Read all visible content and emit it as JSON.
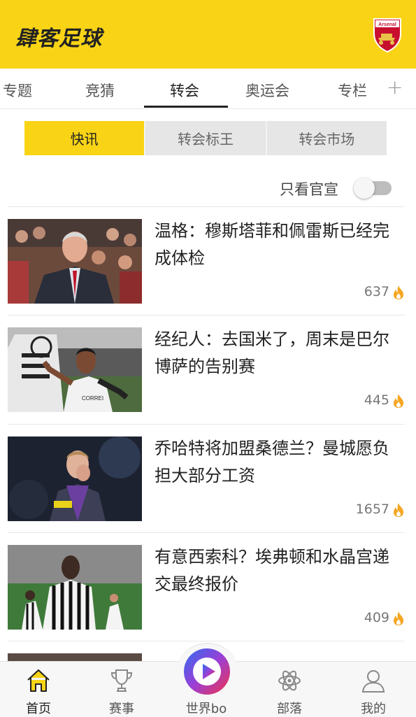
{
  "header": {
    "title": "肆客足球",
    "crest_icon": "arsenal-crest-icon",
    "brand_color": "#f9d416"
  },
  "tabs": [
    {
      "label": "专题",
      "active": false
    },
    {
      "label": "竞猜",
      "active": false
    },
    {
      "label": "转会",
      "active": true
    },
    {
      "label": "奥运会",
      "active": false
    },
    {
      "label": "专栏",
      "active": false
    }
  ],
  "tab_add": "+",
  "segments": [
    {
      "label": "快讯",
      "active": true
    },
    {
      "label": "转会标王",
      "active": false
    },
    {
      "label": "转会市场",
      "active": false
    }
  ],
  "official_filter": {
    "label": "只看官宣",
    "on": false
  },
  "news": [
    {
      "headline": "温格：穆斯塔菲和佩雷斯已经完成体检",
      "count": "637",
      "icon": "fire-icon"
    },
    {
      "headline": "经纪人：去国米了，周末是巴尔博萨的告别赛",
      "count": "445",
      "icon": "fire-icon"
    },
    {
      "headline": "乔哈特将加盟桑德兰？曼城愿负担大部分工资",
      "count": "1657",
      "icon": "fire-icon"
    },
    {
      "headline": "有意西索科？埃弗顿和水晶宫递交最终报价",
      "count": "409",
      "icon": "fire-icon"
    }
  ],
  "bottom_nav": [
    {
      "label": "首页",
      "icon": "home-icon",
      "active": true
    },
    {
      "label": "赛事",
      "icon": "trophy-icon",
      "active": false
    },
    {
      "label": "世界bo",
      "icon": "play-icon",
      "active": false
    },
    {
      "label": "部落",
      "icon": "atom-icon",
      "active": false
    },
    {
      "label": "我的",
      "icon": "user-icon",
      "active": false
    }
  ]
}
